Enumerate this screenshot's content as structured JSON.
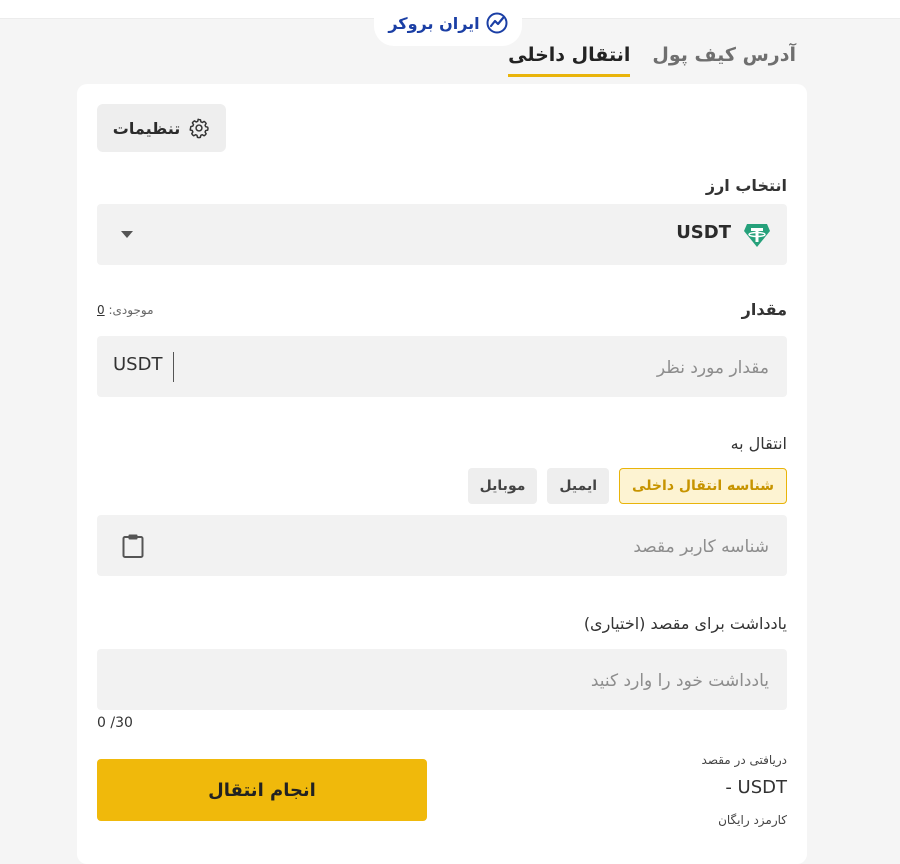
{
  "brand": {
    "logo_text": "ایران بروکر",
    "accent": "#f0b90b",
    "logo_color": "#1b3fa5"
  },
  "tabs": [
    {
      "label": "آدرس کیف پول",
      "active": false
    },
    {
      "label": "انتقال داخلی",
      "active": true
    }
  ],
  "settings": {
    "label": "تنظیمات",
    "icon": "gear-icon"
  },
  "currency": {
    "label": "انتخاب ارز",
    "selected": "USDT",
    "icon": "tether-icon"
  },
  "amount": {
    "label": "مقدار",
    "balance_label": "موجودی:",
    "balance_value": "0",
    "placeholder": "مقدار مورد نظر",
    "value": "",
    "unit": "USDT"
  },
  "transfer_to": {
    "label": "انتقال به",
    "options": [
      {
        "label": "شناسه انتقال داخلی",
        "active": true
      },
      {
        "label": "ایمیل",
        "active": false
      },
      {
        "label": "موبایل",
        "active": false
      }
    ],
    "placeholder": "شناسه کاربر مقصد",
    "value": ""
  },
  "note": {
    "label": "یادداشت برای مقصد (اختیاری)",
    "placeholder": "یادداشت خود را وارد کنید",
    "value": "",
    "counter": "0 /30"
  },
  "summary": {
    "received_label": "دریافتی در مقصد",
    "received_value": "- USDT",
    "fee_label": "کارمزد رایگان"
  },
  "submit": {
    "label": "انجام انتقال"
  }
}
